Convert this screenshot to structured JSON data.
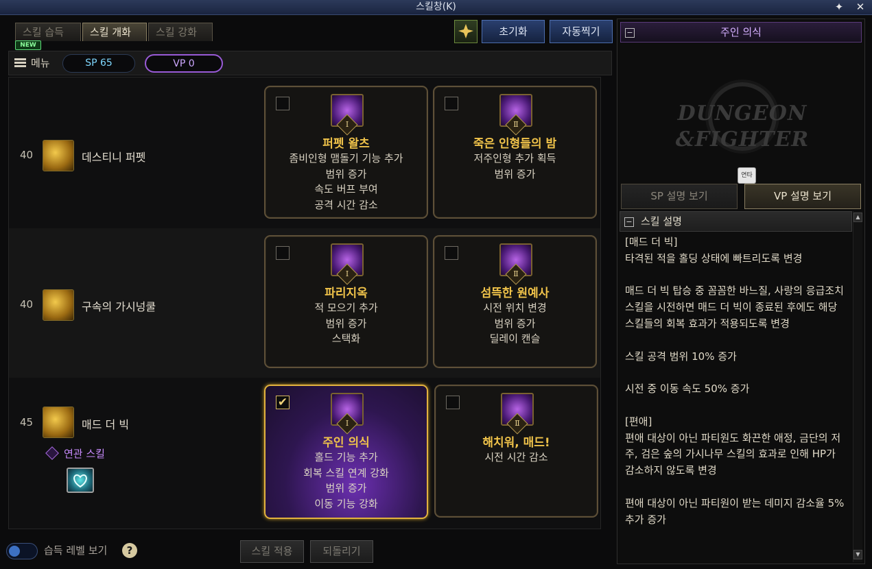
{
  "window": {
    "title": "스킬창(K)",
    "pin_icon": "pin-icon",
    "close_icon": "close-icon"
  },
  "tabs": [
    {
      "label": "스킬 습득",
      "active": false
    },
    {
      "label": "스킬 개화",
      "active": true
    },
    {
      "label": "스킬 강화",
      "active": false
    }
  ],
  "new_badge": "NEW",
  "toolbar": {
    "reset_label": "초기화",
    "auto_label": "자동찍기",
    "icon": "sparkle-tool-icon"
  },
  "menubar": {
    "menu_label": "메뉴",
    "sp": "SP 65",
    "vp": "VP 0"
  },
  "skills": [
    {
      "level": "40",
      "name": "데스티니 퍼펫",
      "options": [
        {
          "title": "퍼펫 왈츠",
          "roman": "Ⅰ",
          "checked": false,
          "selected": false,
          "lines": [
            "좀비인형 맴돌기 기능 추가",
            "범위 증가",
            "속도 버프 부여",
            "공격 시간 감소"
          ]
        },
        {
          "title": "죽은 인형들의 밤",
          "roman": "Ⅱ",
          "checked": false,
          "selected": false,
          "lines": [
            "저주인형 추가 획득",
            "범위 증가"
          ]
        }
      ]
    },
    {
      "level": "40",
      "name": "구속의 가시넝쿨",
      "options": [
        {
          "title": "파리지옥",
          "roman": "Ⅰ",
          "checked": false,
          "selected": false,
          "lines": [
            "적 모으기 추가",
            "범위 증가",
            "스택화"
          ]
        },
        {
          "title": "섬뜩한 원예사",
          "roman": "Ⅱ",
          "checked": false,
          "selected": false,
          "lines": [
            "시전 위치 변경",
            "범위 증가",
            "딜레이 캔슬"
          ]
        }
      ]
    },
    {
      "level": "45",
      "name": "매드 더 빅",
      "options": [
        {
          "title": "주인 의식",
          "roman": "Ⅰ",
          "checked": true,
          "selected": true,
          "lines": [
            "홀드 기능 추가",
            "회복 스킬 연계 강화",
            "범위 증가",
            "이동 기능 강화"
          ]
        },
        {
          "title": "해치워, 매드!",
          "roman": "Ⅱ",
          "checked": false,
          "selected": false,
          "lines": [
            "시전 시간 감소"
          ]
        }
      ]
    }
  ],
  "related": {
    "label": "연관 스킬",
    "icon": "heart-shield-icon"
  },
  "bottom": {
    "toggle_label": "습득 레벨 보기",
    "help": "?",
    "apply_label": "스킬 적용",
    "revert_label": "되돌리기"
  },
  "right_panel": {
    "title": "주인 의식",
    "logo_top": "DUNGEON",
    "logo_bottom": "&FIGHTER",
    "mini_badge": "연타",
    "sp_tab": "SP 설명 보기",
    "vp_tab": "VP 설명 보기",
    "desc_header": "스킬 설명",
    "description": "[매드 더 빅]\n타격된 적을 홀딩 상태에 빠트리도록 변경\n\n매드 더 빅 탑승 중 꼼꼼한 바느질, 사랑의 응급조치 스킬을 시전하면 매드 더 빅이 종료된 후에도 해당 스킬들의 회복 효과가 적용되도록 변경\n\n스킬 공격 범위 10% 증가\n\n시전 중 이동 속도 50% 증가\n\n[편애]\n편애 대상이 아닌 파티원도 화끈한 애정, 금단의 저주, 검은 숲의 가시나무 스킬의 효과로 인해 HP가 감소하지 않도록 변경\n\n편애 대상이 아닌 파티원이 받는 데미지 감소율 5% 추가 증가"
  }
}
